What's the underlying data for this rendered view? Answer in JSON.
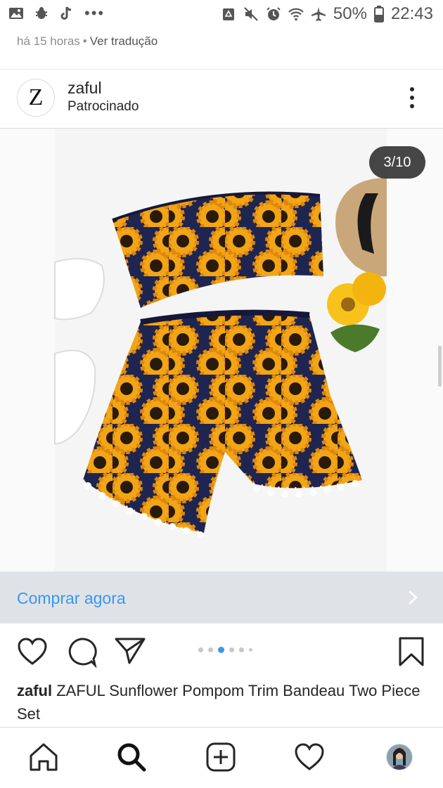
{
  "status_bar": {
    "battery": "50%",
    "time": "22:43",
    "more": "•••"
  },
  "post": {
    "time_ago": "há 15 horas",
    "separator": "•",
    "translate_link": "Ver tradução",
    "account": {
      "avatar_letter": "Z",
      "username": "zaful",
      "sponsored_label": "Patrocinado"
    },
    "media": {
      "counter": "3/10",
      "carousel_total_dots": 6,
      "carousel_active_index": 2
    },
    "cta": {
      "label": "Comprar agora"
    },
    "caption": {
      "username": "zaful",
      "text": " ZAFUL Sunflower Pompom Trim Bandeau Two Piece Set"
    }
  },
  "icons": {
    "status": [
      "image-icon",
      "bug-icon",
      "tiktok-icon",
      "recycle-icon",
      "mute-icon",
      "alarm-icon",
      "wifi-icon",
      "airplane-icon",
      "battery-icon"
    ],
    "actions": [
      "heart-icon",
      "comment-icon",
      "share-icon",
      "bookmark-icon"
    ],
    "nav": [
      "home-icon",
      "search-icon",
      "add-post-icon",
      "activity-heart-icon",
      "profile-avatar"
    ]
  },
  "colors": {
    "accent": "#3897f0",
    "cta_bar": "#dfe3e7",
    "navy_fabric": "#1e2550",
    "sunflower": "#f2a516"
  }
}
